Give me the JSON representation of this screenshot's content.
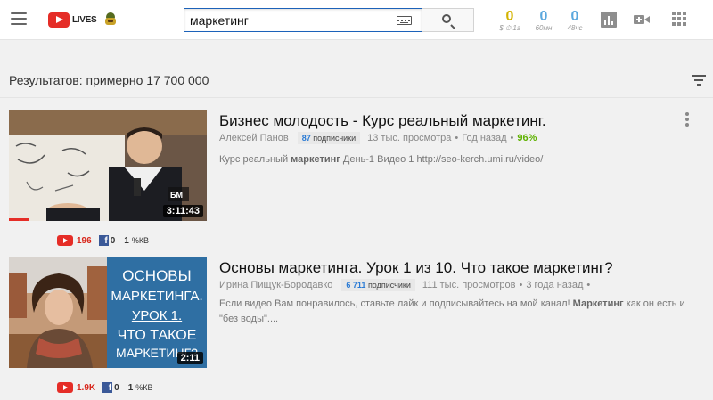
{
  "header": {
    "logo_text": "LIVES",
    "search_value": "маркетинг",
    "stats": [
      {
        "value": "0",
        "label": "$ ⏱ 1г",
        "color": "#d3b300"
      },
      {
        "value": "0",
        "label": "60мн",
        "color": "#5aa7dd"
      },
      {
        "value": "0",
        "label": "48чс",
        "color": "#5aa7dd"
      }
    ],
    "icons": [
      "menu-icon",
      "search-icon",
      "keyboard-icon",
      "analytics-icon",
      "video-upload-icon",
      "apps-grid-icon"
    ]
  },
  "results": {
    "count_text": "Результатов: примерно 17 700 000"
  },
  "videos": [
    {
      "title": "Бизнес молодость - Курс реальный маркетинг.",
      "channel": "Алексей Панов",
      "subs_count": "87",
      "subs_label": "подписчики",
      "views": "13 тыс. просмотра",
      "age": "Год назад",
      "percent": "96%",
      "desc_pre": "Курс реальный ",
      "desc_bold": "маркетинг",
      "desc_post": " День-1 Видео 1 http://seo-kerch.umi.ru/video/",
      "duration": "3:11:43",
      "thumb_badge": "БМ",
      "progress": 0.1,
      "yt_count": "196",
      "fb_count": "0",
      "kb_count": "1",
      "kb_label": "%КВ"
    },
    {
      "title": "Основы маркетинга. Урок 1 из 10. Что такое маркетинг?",
      "channel": "Ирина Пищук-Бородавко",
      "subs_count": "6 711",
      "subs_label": "подписчики",
      "views": "111 тыс. просмотров",
      "age": "3 года назад",
      "desc_pre": "Если видео Вам понравилось, ставьте лайк и подписывайтесь на мой канал! ",
      "desc_bold": "Маркетинг",
      "desc_post": " как он есть и \"без воды\"....",
      "duration": "2:11",
      "thumb_lines": [
        "ОСНОВЫ",
        "МАРКЕТИНГА.",
        "УРОК 1.",
        "ЧТО ТАКОЕ",
        "МАРКЕТИНГ?"
      ],
      "yt_count": "1.9K",
      "fb_count": "0",
      "kb_count": "1",
      "kb_label": "%КВ"
    }
  ]
}
